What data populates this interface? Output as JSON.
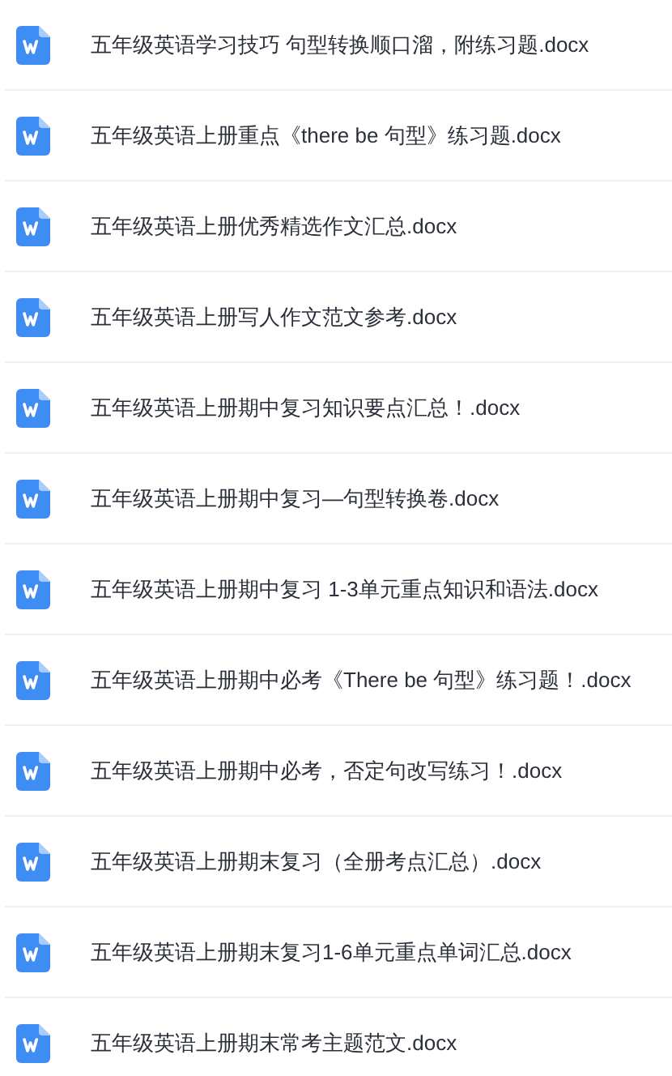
{
  "files": [
    {
      "name": "五年级英语学习技巧 句型转换顺口溜，附练习题.docx"
    },
    {
      "name": "五年级英语上册重点《there be 句型》练习题.docx"
    },
    {
      "name": "五年级英语上册优秀精选作文汇总.docx"
    },
    {
      "name": "五年级英语上册写人作文范文参考.docx"
    },
    {
      "name": "五年级英语上册期中复习知识要点汇总！.docx"
    },
    {
      "name": "五年级英语上册期中复习—句型转换卷.docx"
    },
    {
      "name": "五年级英语上册期中复习 1-3单元重点知识和语法.docx"
    },
    {
      "name": "五年级英语上册期中必考《There be 句型》练习题！.docx"
    },
    {
      "name": "五年级英语上册期中必考，否定句改写练习！.docx"
    },
    {
      "name": "五年级英语上册期末复习（全册考点汇总）.docx"
    },
    {
      "name": "五年级英语上册期末复习1-6单元重点单词汇总.docx"
    },
    {
      "name": "五年级英语上册期末常考主题范文.docx"
    }
  ]
}
